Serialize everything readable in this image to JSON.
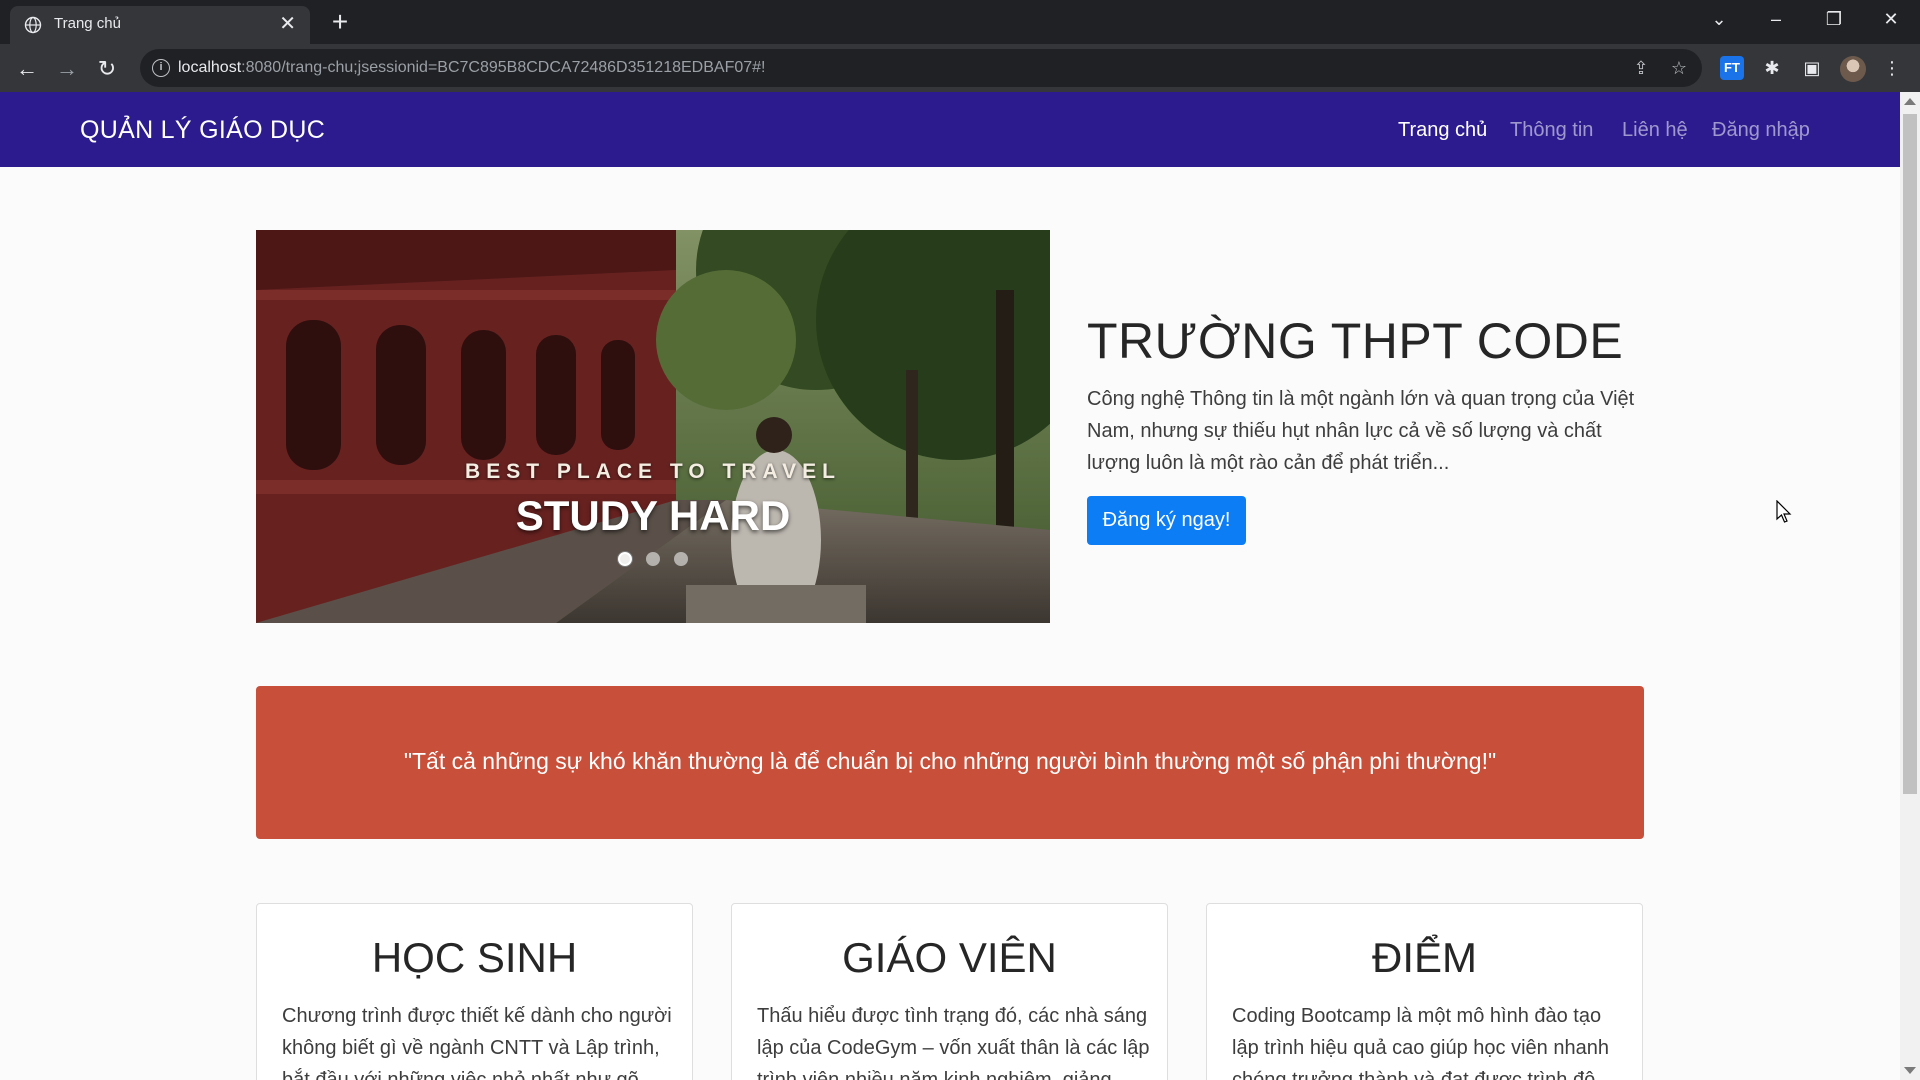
{
  "browser": {
    "tab_title": "Trang chủ",
    "url_host": "localhost",
    "url_rest": ":8080/trang-chu;jsessionid=BC7C895B8CDCA72486D351218EDBAF07#!",
    "extension_label": "FT"
  },
  "navbar": {
    "brand": "QUẢN LÝ GIÁO DỤC",
    "links": [
      "Trang chủ",
      "Thông tin",
      "Liên hệ",
      "Đăng nhập"
    ]
  },
  "carousel": {
    "subtitle": "BEST PLACE TO TRAVEL",
    "title": "STUDY HARD",
    "slide_count": 3,
    "active_slide": 1
  },
  "hero": {
    "title": "TRƯỜNG THPT CODE",
    "text": "Công nghệ Thông tin là một ngành lớn và quan trọng của Việt Nam, nhưng sự thiếu hụt nhân lực cả về số lượng và chất lượng luôn là một rào cản để phát triển...",
    "button": "Đăng ký ngay!"
  },
  "quote": "\"Tất cả những sự khó khăn thường là để chuẩn bị cho những người bình thường một số phận phi thường!\"",
  "cards": [
    {
      "title": "HỌC SINH",
      "text": "Chương trình được thiết kế dành cho người không biết gì về ngành CNTT và Lập trình, bắt đầu với những việc nhỏ nhất như gõ"
    },
    {
      "title": "GIÁO VIÊN",
      "text": "Thấu hiểu được tình trạng đó, các nhà sáng lập của CodeGym – vốn xuất thân là các lập trình viên nhiều năm kinh nghiệm, giảng"
    },
    {
      "title": "ĐIỂM",
      "text": "Coding Bootcamp là một mô hình đào tạo lập trình hiệu quả cao giúp học viên nhanh chóng trưởng thành và đạt được trình độ"
    }
  ],
  "colors": {
    "navbar": "#2b1b8f",
    "button": "#0d7df6",
    "quote_bg": "#c8503a"
  }
}
